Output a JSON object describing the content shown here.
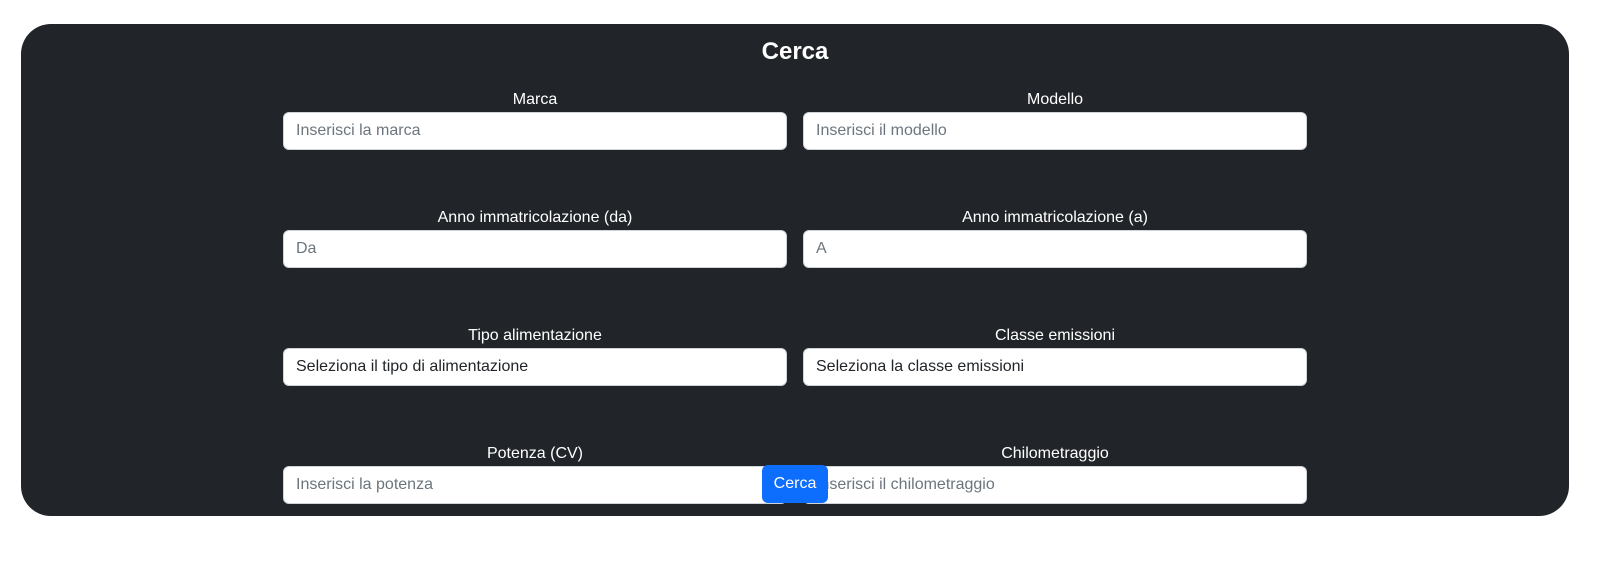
{
  "form": {
    "title": "Cerca",
    "brand": {
      "label": "Marca",
      "placeholder": "Inserisci la marca",
      "value": ""
    },
    "model": {
      "label": "Modello",
      "placeholder": "Inserisci il modello",
      "value": ""
    },
    "year_from": {
      "label": "Anno immatricolazione (da)",
      "placeholder": "Da",
      "value": ""
    },
    "year_to": {
      "label": "Anno immatricolazione (a)",
      "placeholder": "A",
      "value": ""
    },
    "fuel_type": {
      "label": "Tipo alimentazione",
      "selected": "Seleziona il tipo di alimentazione"
    },
    "emission_class": {
      "label": "Classe emissioni",
      "selected": "Seleziona la classe emissioni"
    },
    "power": {
      "label": "Potenza (CV)",
      "placeholder": "Inserisci la potenza",
      "value": ""
    },
    "mileage": {
      "label": "Chilometraggio",
      "placeholder": "Inserisci il chilometraggio",
      "value": ""
    },
    "submit_label": "Cerca"
  },
  "colors": {
    "panel_bg": "#212529",
    "button_bg": "#0d6efd",
    "text_light": "#ffffff",
    "placeholder": "#6c757d"
  }
}
